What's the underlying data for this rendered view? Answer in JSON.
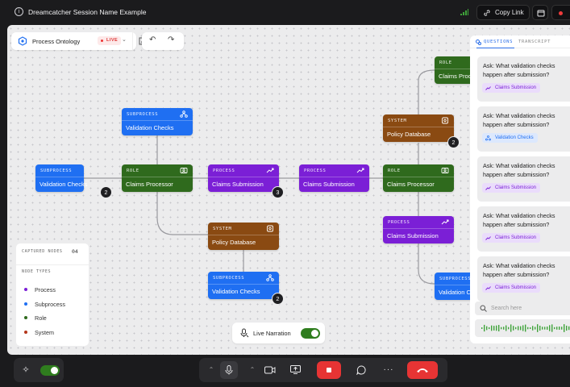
{
  "header": {
    "session_title": "Dreamcatcher Session Name Example",
    "copy_link_label": "Copy Link"
  },
  "toolbar": {
    "ontology_name": "Process Ontology",
    "live_badge": "LIVE"
  },
  "nodes": [
    {
      "id": "n1",
      "type": "SUBPROCESS",
      "label": "Validation Checks",
      "color": "blue"
    },
    {
      "id": "n2",
      "type": "SUBPROCESS",
      "label": "Validation Checks",
      "color": "blue",
      "badge": "2"
    },
    {
      "id": "n3",
      "type": "ROLE",
      "label": "Claims Processor",
      "color": "green"
    },
    {
      "id": "n4",
      "type": "PROCESS",
      "label": "Claims Submission",
      "color": "purple",
      "badge": "3"
    },
    {
      "id": "n5",
      "type": "SYSTEM",
      "label": "Policy Database",
      "color": "brown"
    },
    {
      "id": "n6",
      "type": "SUBPROCESS",
      "label": "Validation Checks",
      "color": "blue",
      "badge": "2"
    },
    {
      "id": "n7",
      "type": "PROCESS",
      "label": "Claims Submission",
      "color": "purple"
    },
    {
      "id": "n8",
      "type": "ROLE",
      "label": "Claims Processor",
      "color": "green"
    },
    {
      "id": "n9",
      "type": "ROLE",
      "label": "Claims Proc",
      "color": "green"
    },
    {
      "id": "n10",
      "type": "SYSTEM",
      "label": "Policy Database",
      "color": "brown",
      "badge": "2"
    },
    {
      "id": "n11",
      "type": "PROCESS",
      "label": "Claims Submission",
      "color": "purple"
    },
    {
      "id": "n12",
      "type": "SUBPROCESS",
      "label": "Validation C",
      "color": "blue"
    }
  ],
  "legend": {
    "captured_label": "CAPTURED NODES",
    "captured_count": "04",
    "types_label": "NODE TYPES",
    "types": [
      {
        "label": "Process",
        "color": "#7b1fd6"
      },
      {
        "label": "Subprocess",
        "color": "#1f6ff2"
      },
      {
        "label": "Role",
        "color": "#2f6a1d"
      },
      {
        "label": "System",
        "color": "#b4361b"
      }
    ]
  },
  "narration": {
    "label": "Live Narration",
    "enabled": true
  },
  "sidebar": {
    "tabs": [
      "QUESTIONS",
      "TRANSCRIPT"
    ],
    "active_tab": "QUESTIONS",
    "questions": [
      {
        "text": "Ask: What validation checks happen after submission?",
        "tag": "Claims Submission",
        "tag_color": "purple"
      },
      {
        "text": "Ask: What validation checks happen after submission?",
        "tag": "Validation Checks",
        "tag_color": "blue"
      },
      {
        "text": "Ask: What validation checks happen after submission?",
        "tag": "Claims Submission",
        "tag_color": "purple"
      },
      {
        "text": "Ask: What validation checks happen after submission?",
        "tag": "Claims Submission",
        "tag_color": "purple"
      },
      {
        "text": "Ask: What validation checks happen after submission?",
        "tag": "Claims Submission",
        "tag_color": "purple"
      }
    ],
    "search_placeholder": "Search here"
  },
  "controls": {
    "ai_toggle_enabled": true
  }
}
